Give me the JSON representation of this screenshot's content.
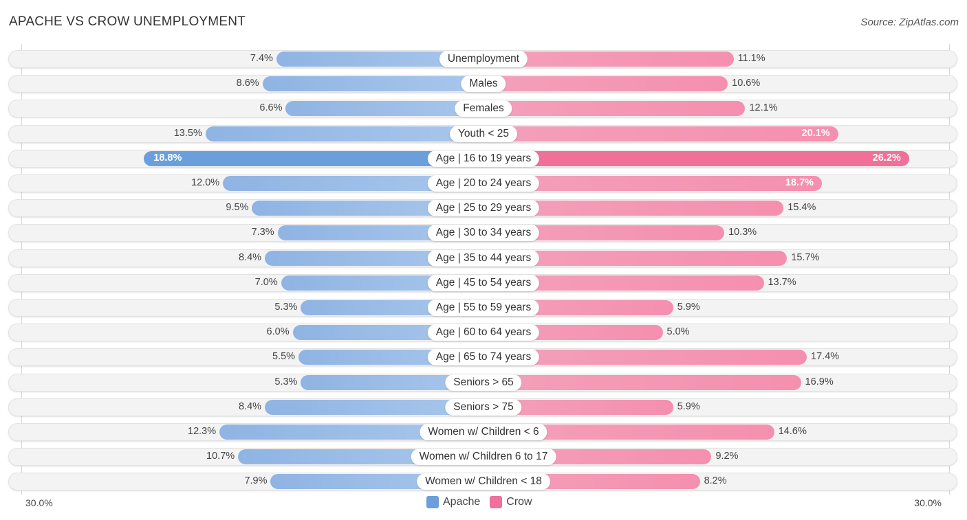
{
  "title": "APACHE VS CROW UNEMPLOYMENT",
  "source": "Source: ZipAtlas.com",
  "colors": {
    "apache": "#6a9fdc",
    "crow": "#f07099"
  },
  "chart_data": {
    "type": "bar",
    "orientation": "horizontal-diverging",
    "title": "APACHE VS CROW UNEMPLOYMENT",
    "xlim": [
      -30,
      30
    ],
    "axis_tick_labels": {
      "left": "30.0%",
      "right": "30.0%"
    },
    "legend": {
      "position": "bottom-center",
      "entries": [
        "Apache",
        "Crow"
      ]
    },
    "categories": [
      "Unemployment",
      "Males",
      "Females",
      "Youth < 25",
      "Age | 16 to 19 years",
      "Age | 20 to 24 years",
      "Age | 25 to 29 years",
      "Age | 30 to 34 years",
      "Age | 35 to 44 years",
      "Age | 45 to 54 years",
      "Age | 55 to 59 years",
      "Age | 60 to 64 years",
      "Age | 65 to 74 years",
      "Seniors > 65",
      "Seniors > 75",
      "Women w/ Children < 6",
      "Women w/ Children 6 to 17",
      "Women w/ Children < 18"
    ],
    "series": [
      {
        "name": "Apache",
        "side": "left",
        "values": [
          7.4,
          8.6,
          6.6,
          13.5,
          18.8,
          12.0,
          9.5,
          7.3,
          8.4,
          7.0,
          5.3,
          6.0,
          5.5,
          5.3,
          8.4,
          12.3,
          10.7,
          7.9
        ]
      },
      {
        "name": "Crow",
        "side": "right",
        "values": [
          11.1,
          10.6,
          12.1,
          20.1,
          26.2,
          18.7,
          15.4,
          10.3,
          15.7,
          13.7,
          5.9,
          5.0,
          17.4,
          16.9,
          5.9,
          14.6,
          9.2,
          8.2
        ]
      }
    ],
    "value_labels": {
      "Apache": [
        "7.4%",
        "8.6%",
        "6.6%",
        "13.5%",
        "18.8%",
        "12.0%",
        "9.5%",
        "7.3%",
        "8.4%",
        "7.0%",
        "5.3%",
        "6.0%",
        "5.5%",
        "5.3%",
        "8.4%",
        "12.3%",
        "10.7%",
        "7.9%"
      ],
      "Crow": [
        "11.1%",
        "10.6%",
        "12.1%",
        "20.1%",
        "26.2%",
        "18.7%",
        "15.4%",
        "10.3%",
        "15.7%",
        "13.7%",
        "5.9%",
        "5.0%",
        "17.4%",
        "16.9%",
        "5.9%",
        "14.6%",
        "9.2%",
        "8.2%"
      ]
    }
  }
}
